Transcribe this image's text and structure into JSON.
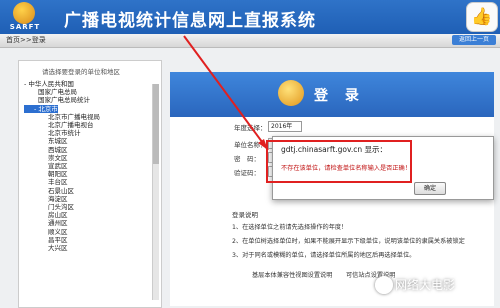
{
  "header": {
    "title": "广播电视统计信息网上直报系统",
    "logo_text": "SARFT",
    "like_icon": "thumb-up-icon"
  },
  "breadcrumb": {
    "text": "首页>>登录",
    "back_label": "返回上一页"
  },
  "tree": {
    "title": "请选择要登录的单位和地区",
    "items": [
      "- 中华人民共和国",
      "国家广电总局",
      "国家广电总局统计",
      "- 北京市",
      "北京市广播电视局",
      "北京广播电视台",
      "北京市统计",
      "东城区",
      "西城区",
      "崇文区",
      "宣武区",
      "朝阳区",
      "丰台区",
      "石景山区",
      "海淀区",
      "门头沟区",
      "房山区",
      "通州区",
      "顺义区",
      "昌平区",
      "大兴区"
    ]
  },
  "login": {
    "title": "登 录",
    "year_label": "年度选择：",
    "year_value": "2016年",
    "unit_label": "单位名称：",
    "password_label": "密　码：",
    "captcha_label": "验证码："
  },
  "dialog": {
    "title": "gdtj.chinasarft.gov.cn 显示：",
    "message": "不存在该单位，请检查单位名称输入是否正确！",
    "ok_label": "确定"
  },
  "notes": {
    "title": "登录说明",
    "lines": [
      "1、在选择单位之前请先选择操作的年度！",
      "2、在单位树选择单位时，如果不能展开显示下级单位，说明该单位的隶属关系被锁定",
      "3、对于同名或模糊的单位，请选择单位所属的地区后再选择单位。"
    ]
  },
  "footer": {
    "link1": "基层本体兼容性视图设置说明",
    "link2": "可信站点设置说明"
  },
  "watermark": {
    "text": "网络大电影"
  }
}
